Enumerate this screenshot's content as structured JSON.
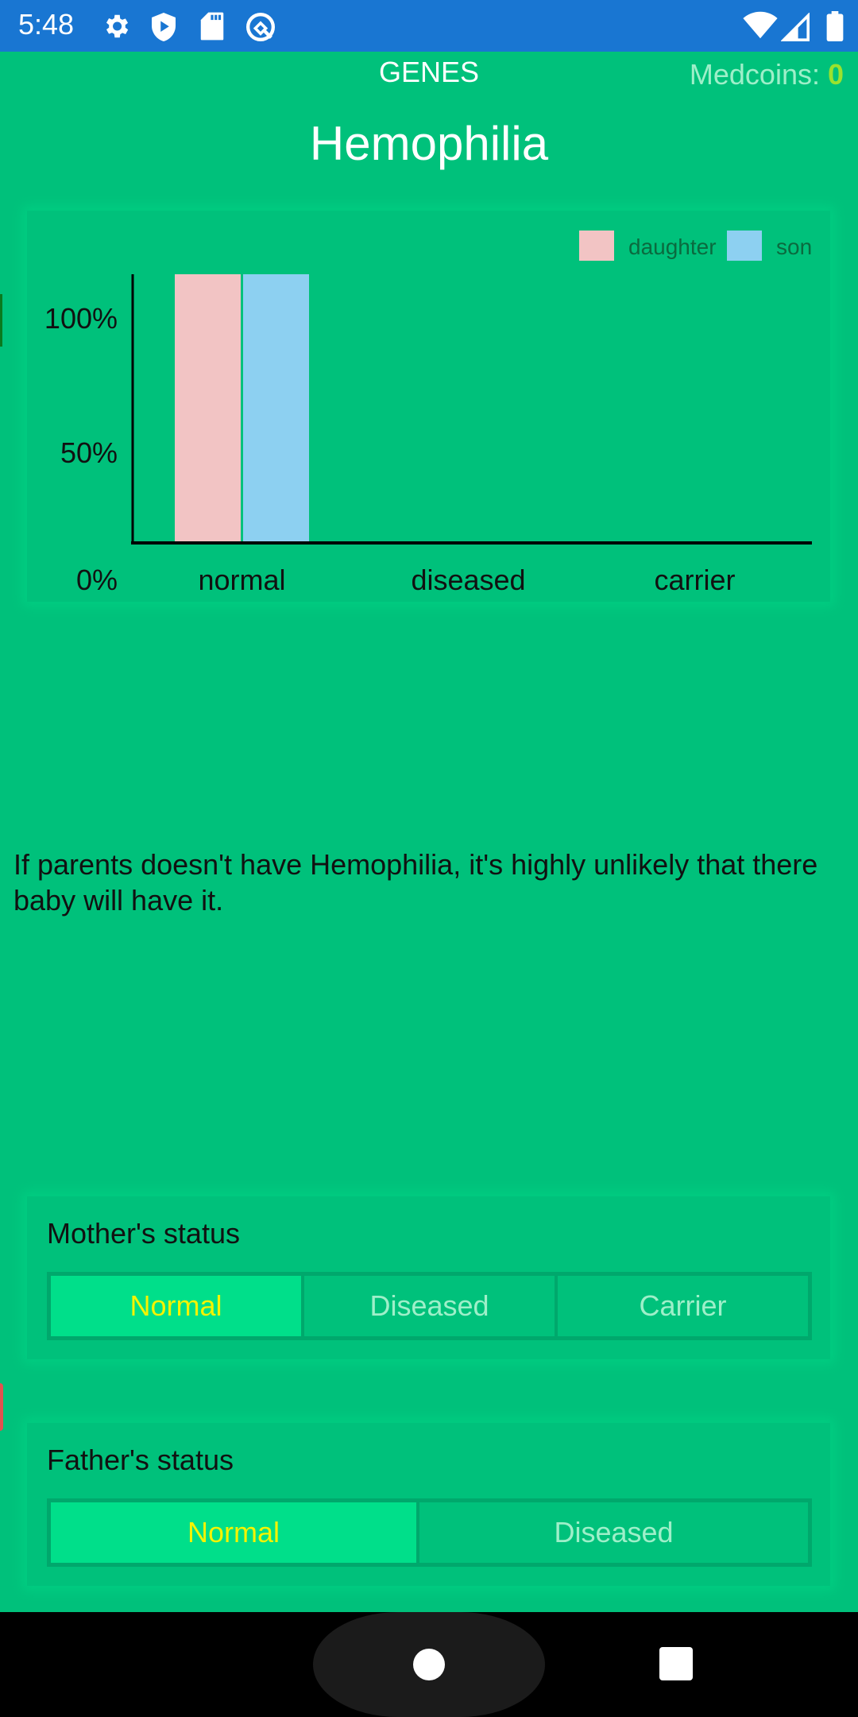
{
  "status_bar": {
    "time": "5:48",
    "left_icons": [
      "settings-gear-icon",
      "play-protect-shield-icon",
      "sd-card-icon",
      "android-q-icon"
    ],
    "right_icons": [
      "wifi-icon",
      "cellular-signal-icon",
      "battery-icon"
    ]
  },
  "header": {
    "section": "GENES",
    "medcoins_label": "Medcoins: ",
    "medcoins_value": "0",
    "title": "Hemophilia"
  },
  "colors": {
    "background": "#00C17B",
    "status_bar": "#1976D2",
    "daughter": "#F2C4C4",
    "son": "#8DD0F1",
    "selected_text": "#F4F400",
    "unselected_text": "#9EEFC9"
  },
  "chart_data": {
    "type": "bar",
    "title": "",
    "xlabel": "",
    "ylabel": "",
    "categories": [
      "normal",
      "diseased",
      "carrier"
    ],
    "series": [
      {
        "name": "daughter",
        "values": [
          100,
          0,
          0
        ]
      },
      {
        "name": "son",
        "values": [
          100,
          0,
          0
        ]
      }
    ],
    "ylim": [
      0,
      100
    ],
    "y_ticks": [
      {
        "value": 0,
        "label": "0%"
      },
      {
        "value": 50,
        "label": "50%"
      },
      {
        "value": 100,
        "label": "100%"
      }
    ],
    "legend": {
      "position": "top-right",
      "entries": [
        "daughter",
        "son"
      ]
    },
    "grid": false
  },
  "description": "If parents doesn't have Hemophilia, it's highly unlikely that there baby will have it.",
  "mother": {
    "label": "Mother's status",
    "options": [
      "Normal",
      "Diseased",
      "Carrier"
    ],
    "selected": "Normal"
  },
  "father": {
    "label": "Father's status",
    "options": [
      "Normal",
      "Diseased"
    ],
    "selected": "Normal"
  },
  "nav": {
    "buttons": [
      "home-button",
      "recents-button"
    ]
  }
}
